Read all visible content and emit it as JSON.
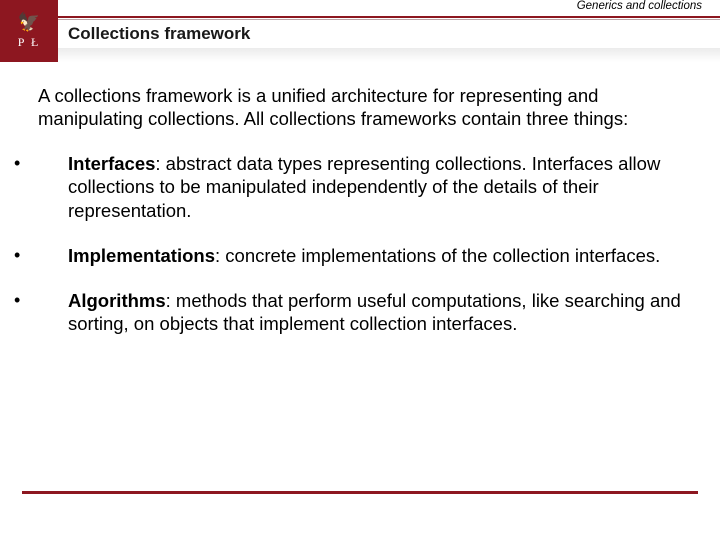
{
  "colors": {
    "accent": "#8d1720"
  },
  "header": {
    "topic": "Generics and collections",
    "title": "Collections framework",
    "logo": {
      "eagle_glyph": "🦅",
      "letters": "P Ł"
    }
  },
  "content": {
    "intro": "A collections framework is a unified architecture for representing and manipulating collections. All collections frameworks contain three things:",
    "items": [
      {
        "term": "Interfaces",
        "text": ": abstract data types representing collections. Interfaces allow collections to be manipulated independently of the details of their representation."
      },
      {
        "term": "Implementations",
        "text": ": concrete implementations of the collection interfaces."
      },
      {
        "term": "Algorithms",
        "text": ": methods that perform useful computations, like searching and sorting, on objects that implement collection interfaces."
      }
    ]
  }
}
